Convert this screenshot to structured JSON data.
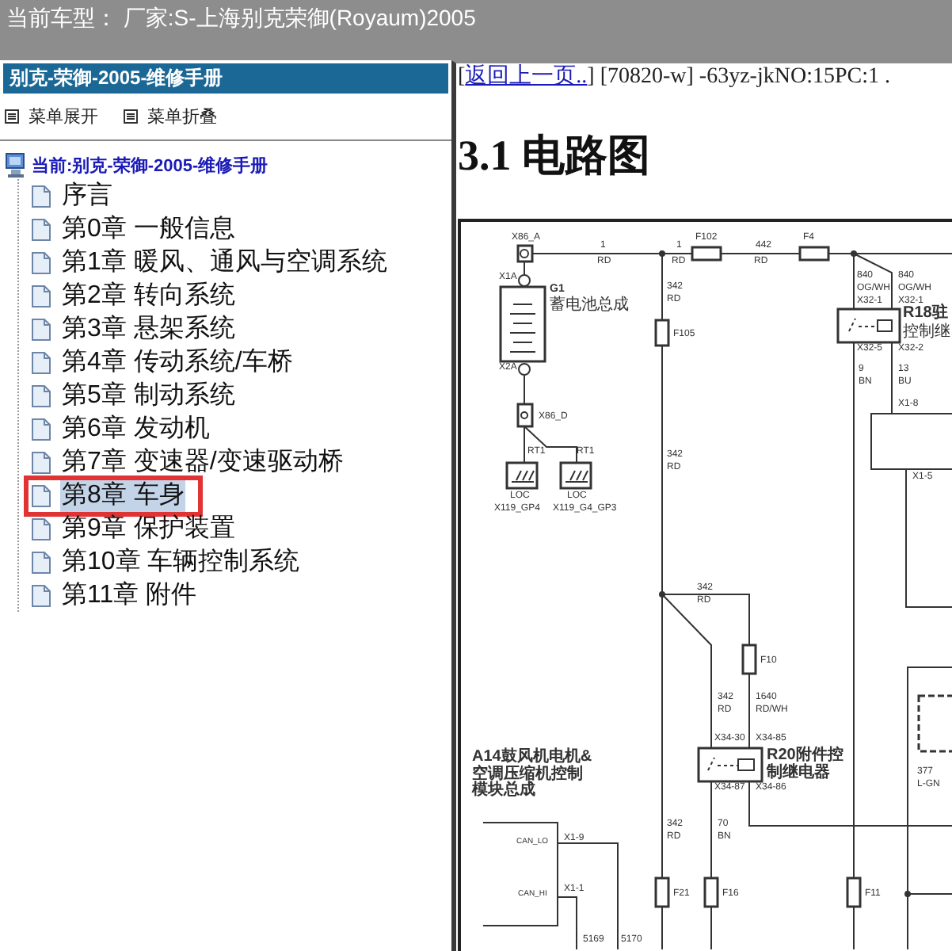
{
  "header": {
    "title": "当前车型： 厂家:S-上海别克荣御(Royaum)2005"
  },
  "sidebar": {
    "title": "别克-荣御-2005-维修手册",
    "actions": [
      "菜单展开",
      "菜单折叠"
    ],
    "tree": {
      "label": "当前:别克-荣御-2005-维修手册",
      "children": [
        {
          "label": "序言",
          "selected": false,
          "highlighted": false
        },
        {
          "label": "第0章 一般信息",
          "selected": false,
          "highlighted": false
        },
        {
          "label": "第1章 暖风、通风与空调系统",
          "selected": false,
          "highlighted": false
        },
        {
          "label": "第2章 转向系统",
          "selected": false,
          "highlighted": false
        },
        {
          "label": "第3章 悬架系统",
          "selected": false,
          "highlighted": false
        },
        {
          "label": "第4章 传动系统/车桥",
          "selected": false,
          "highlighted": false
        },
        {
          "label": "第5章 制动系统",
          "selected": false,
          "highlighted": false
        },
        {
          "label": "第6章 发动机",
          "selected": false,
          "highlighted": false
        },
        {
          "label": "第7章 变速器/变速驱动桥",
          "selected": false,
          "highlighted": false
        },
        {
          "label": "第8章 车身",
          "selected": true,
          "highlighted": true
        },
        {
          "label": "第9章 保护装置",
          "selected": false,
          "highlighted": false
        },
        {
          "label": "第10章 车辆控制系统",
          "selected": false,
          "highlighted": false
        },
        {
          "label": "第11章 附件",
          "selected": false,
          "highlighted": false
        }
      ]
    }
  },
  "content": {
    "nav_prefix": "[",
    "back_link": "返回上一页..",
    "nav_suffix": "] [70820-w] -63yz-jkNO:15PC:1 .",
    "heading": "3.1 电路图",
    "diagram": {
      "labels": [
        "X86_A",
        "1",
        "RD",
        "1",
        "RD",
        "F102",
        "442",
        "RD",
        "F4",
        "840",
        "OG/WH",
        "840",
        "OG/WH",
        "X1A",
        "G1",
        "蓄电池总成",
        "342",
        "RD",
        "X32-1",
        "X32-1",
        "R18驻",
        "控制继",
        "F105",
        "X2A",
        "X32-5",
        "X32-2",
        "9",
        "BN",
        "13",
        "BU",
        "X1-8",
        "X86_D",
        "RT1",
        "RT1",
        "342",
        "RD",
        "X1-5",
        "LOC",
        "X119_GP4",
        "LOC",
        "X119_G4_GP3",
        "342",
        "RD",
        "F10",
        "342",
        "RD",
        "1640",
        "RD/WH",
        "X34-30",
        "X34-85",
        "R20附件控制继电器",
        "X34-87",
        "X34-86",
        "A14鼓风机电机&空调压缩机控制模块总成",
        "377",
        "L-GN",
        "CAN_LO",
        "X1-9",
        "342",
        "RD",
        "70",
        "BN",
        "CAN_HI",
        "X1-1",
        "F21",
        "F16",
        "F11",
        "5169",
        "5170"
      ]
    }
  }
}
